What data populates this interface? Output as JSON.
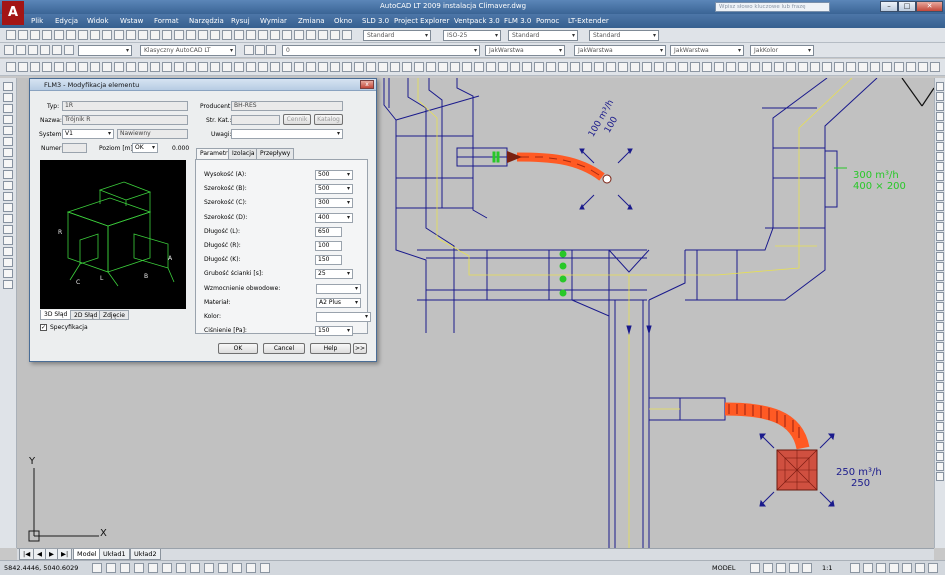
{
  "window": {
    "title": "AutoCAD LT 2009 instalacja Climaver.dwg",
    "help_placeholder": "Wpisz słowo kluczowe lub frazę",
    "logo_letter": "A"
  },
  "menu": [
    "Plik",
    "Edycja",
    "Widok",
    "Wstaw",
    "Format",
    "Narzędzia",
    "Rysuj",
    "Wymiar",
    "Zmiana",
    "Okno",
    "SLD 3.0",
    "Project Explorer",
    "Ventpack 3.0",
    "FLM 3.0",
    "Pomoc",
    "LT-Extender"
  ],
  "toolbar1": {
    "text_style": "Standard",
    "dim_style": "ISO-25",
    "table_style": "Standard",
    "mleader_style": "Standard"
  },
  "toolbar2": {
    "workspace": "Klasyczny AutoCAD LT",
    "layer": "0",
    "color": "JakWarstwa",
    "linetype": "JakWarstwa",
    "lineweight": "JakWarstwa",
    "plotstyle": "JakKolor"
  },
  "dialog": {
    "title": "FLM3 - Modyfikacja elementu",
    "close": "x",
    "typ_label": "Typ:",
    "typ_value": "1R",
    "nazwa_label": "Nazwa:",
    "nazwa_value": "Trójnik R",
    "system_label": "System:",
    "system_value": "V1",
    "system_type": "Nawiewny",
    "numer_label": "Numer:",
    "poziom_label": "Poziom [m]:",
    "poziom_ref": "OK",
    "poziom_value": "0.000",
    "producent_label": "Producent:",
    "producent_value": "BH-RES",
    "strkat_label": "Str. Kat.:",
    "cennik": "Cennik",
    "katalog": "Katalog",
    "uwagi_label": "Uwagi:",
    "preview_tabs": [
      "3D Słąd",
      "2D Słąd",
      "Zdjęcie"
    ],
    "spec_label": "Specyfikacja",
    "right_tabs": [
      "Parametry",
      "Izolacja",
      "Przepływy"
    ],
    "params": [
      {
        "label": "Wysokość (A):",
        "value": "500",
        "kind": "dd"
      },
      {
        "label": "Szerokość (B):",
        "value": "500",
        "kind": "dd"
      },
      {
        "label": "Szerokość (C):",
        "value": "300",
        "kind": "dd"
      },
      {
        "label": "Szerokość (D):",
        "value": "400",
        "kind": "dd"
      },
      {
        "label": "Długość (L):",
        "value": "650",
        "kind": "in"
      },
      {
        "label": "Długość (R):",
        "value": "100",
        "kind": "in"
      },
      {
        "label": "Długość (K):",
        "value": "150",
        "kind": "in"
      },
      {
        "label": "Grubość ścianki [s]:",
        "value": "25",
        "kind": "dd"
      },
      {
        "label": "Wzmocnienie obwodowe:",
        "value": "",
        "kind": "dd"
      },
      {
        "label": "Materiał:",
        "value": "A2 Plus",
        "kind": "dd"
      },
      {
        "label": "Kolor:",
        "value": "",
        "kind": "dd"
      },
      {
        "label": "Ciśnienie [Pa]:",
        "value": "150",
        "kind": "dd"
      }
    ],
    "ok": "OK",
    "cancel": "Cancel",
    "help": "Help",
    "more": ">>"
  },
  "drawing": {
    "flow_top_rot1": "100 m³/h",
    "flow_top_rot2": "100",
    "flow_right": "300 m³/h",
    "flow_right_size": "400 × 200",
    "flow_bottom": "250 m³/h",
    "flow_bottom_sub": "250",
    "axis_y": "Y",
    "axis_x": "X",
    "colors": {
      "duct": "#1a1a8c",
      "flex": "#ff4a1a",
      "green": "#28c828",
      "yellow": "#e8e050",
      "canvas": "#c1c1c1"
    }
  },
  "tabs": [
    "Model",
    "Układ1",
    "Układ2"
  ],
  "status": {
    "coords": "5842.4446, 5040.6029",
    "model": "MODEL",
    "scale": "1:1"
  }
}
